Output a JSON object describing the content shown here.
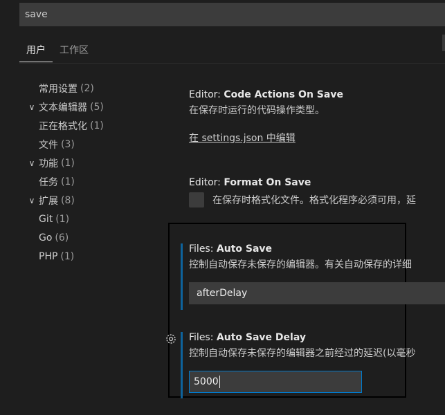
{
  "search": {
    "value": "save"
  },
  "tabs": [
    {
      "label": "用户",
      "active": true
    },
    {
      "label": "工作区",
      "active": false
    }
  ],
  "tree": [
    {
      "label": "常用设置",
      "count": "(2)",
      "level": 0,
      "chevron": ""
    },
    {
      "label": "文本编辑器",
      "count": "(5)",
      "level": 0,
      "chevron": "chevron-down-icon"
    },
    {
      "label": "正在格式化",
      "count": "(1)",
      "level": 1,
      "chevron": ""
    },
    {
      "label": "文件",
      "count": "(3)",
      "level": 1,
      "chevron": ""
    },
    {
      "label": "功能",
      "count": "(1)",
      "level": 0,
      "chevron": "chevron-down-icon"
    },
    {
      "label": "任务",
      "count": "(1)",
      "level": 1,
      "chevron": ""
    },
    {
      "label": "扩展",
      "count": "(8)",
      "level": 0,
      "chevron": "chevron-down-icon"
    },
    {
      "label": "Git",
      "count": "(1)",
      "level": 1,
      "chevron": ""
    },
    {
      "label": "Go",
      "count": "(6)",
      "level": 1,
      "chevron": ""
    },
    {
      "label": "PHP",
      "count": "(1)",
      "level": 1,
      "chevron": ""
    }
  ],
  "settings": {
    "code_actions": {
      "category": "Editor: ",
      "name": "Code Actions On Save",
      "description": "在保存时运行的代码操作类型。",
      "link": "在 settings.json 中编辑"
    },
    "format_on_save": {
      "category": "Editor: ",
      "name": "Format On Save",
      "description": "在保存时格式化文件。格式化程序必须可用，延",
      "checked": false
    },
    "auto_save": {
      "category": "Files: ",
      "name": "Auto Save",
      "description": "控制自动保存未保存的编辑器。有关自动保存的详细",
      "value": "afterDelay"
    },
    "auto_save_delay": {
      "category": "Files: ",
      "name": "Auto Save Delay",
      "description": "控制自动保存未保存的编辑器之前经过的延迟(以毫秒",
      "value": "5000"
    }
  },
  "colors": {
    "background": "#1e1e1e",
    "input_bg": "#3c3c3c",
    "modified_bar": "#0e639c",
    "focus_border": "#007acc"
  }
}
